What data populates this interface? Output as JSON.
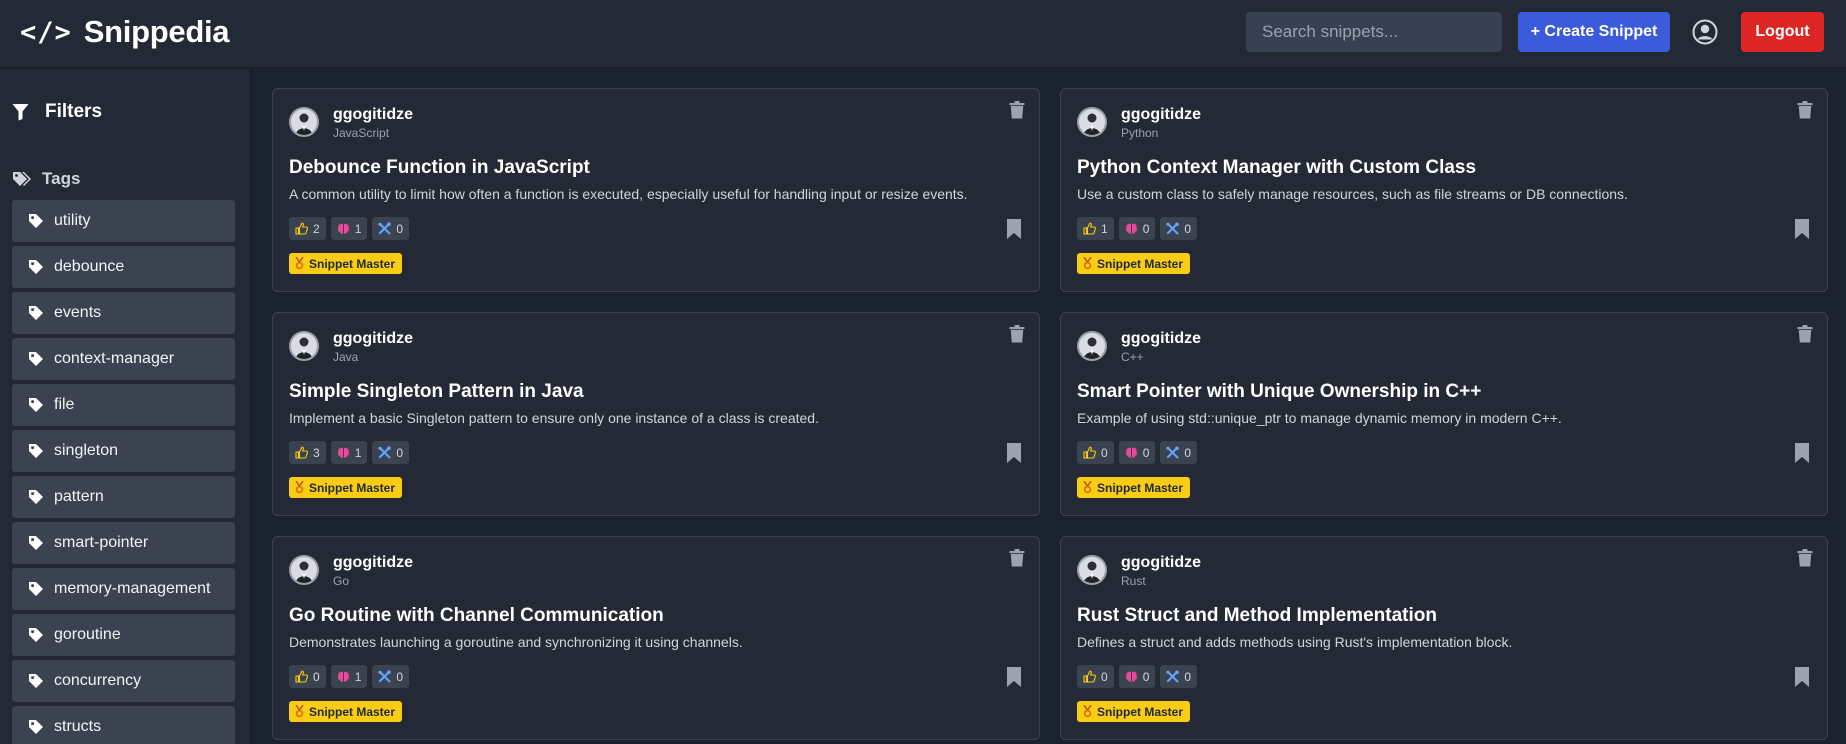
{
  "header": {
    "logo_icon": "</>",
    "app_name": "Snippedia",
    "search_placeholder": "Search snippets...",
    "create_label": "+ Create Snippet",
    "logout_label": "Logout"
  },
  "sidebar": {
    "filters_label": "Filters",
    "tags_label": "Tags",
    "tags": [
      "utility",
      "debounce",
      "events",
      "context-manager",
      "file",
      "singleton",
      "pattern",
      "smart-pointer",
      "memory-management",
      "goroutine",
      "concurrency",
      "structs"
    ]
  },
  "snippets": [
    {
      "author": "ggogitidze",
      "language": "JavaScript",
      "title": "Debounce Function in JavaScript",
      "description": "A common utility to limit how often a function is executed, especially useful for handling input or resize events.",
      "likes": "2",
      "brain": "1",
      "tools": "0",
      "badge": "Snippet Master"
    },
    {
      "author": "ggogitidze",
      "language": "Python",
      "title": "Python Context Manager with Custom Class",
      "description": "Use a custom class to safely manage resources, such as file streams or DB connections.",
      "likes": "1",
      "brain": "0",
      "tools": "0",
      "badge": "Snippet Master"
    },
    {
      "author": "ggogitidze",
      "language": "Java",
      "title": "Simple Singleton Pattern in Java",
      "description": "Implement a basic Singleton pattern to ensure only one instance of a class is created.",
      "likes": "3",
      "brain": "1",
      "tools": "0",
      "badge": "Snippet Master"
    },
    {
      "author": "ggogitidze",
      "language": "C++",
      "title": "Smart Pointer with Unique Ownership in C++",
      "description": "Example of using std::unique_ptr to manage dynamic memory in modern C++.",
      "likes": "0",
      "brain": "0",
      "tools": "0",
      "badge": "Snippet Master"
    },
    {
      "author": "ggogitidze",
      "language": "Go",
      "title": "Go Routine with Channel Communication",
      "description": "Demonstrates launching a goroutine and synchronizing it using channels.",
      "likes": "0",
      "brain": "1",
      "tools": "0",
      "badge": "Snippet Master"
    },
    {
      "author": "ggogitidze",
      "language": "Rust",
      "title": "Rust Struct and Method Implementation",
      "description": "Defines a struct and adds methods using Rust's implementation block.",
      "likes": "0",
      "brain": "0",
      "tools": "0",
      "badge": "Snippet Master"
    }
  ],
  "icons": {
    "filter": "filter-icon",
    "tags": "tags-icon",
    "tag": "tag-icon",
    "user": "user-circle-icon",
    "delete": "trash-icon",
    "like": "thumbs-up-icon",
    "brain": "brain-icon",
    "tools": "tools-icon",
    "bookmark": "bookmark-icon",
    "badge": "medal-icon"
  },
  "colors": {
    "background": "#1b2230",
    "panel": "#232a36",
    "primary": "#3b5bdb",
    "danger": "#dc2626",
    "badge": "#facc15",
    "like": "#facc15",
    "brain": "#ec4899",
    "tools": "#60a5fa"
  }
}
